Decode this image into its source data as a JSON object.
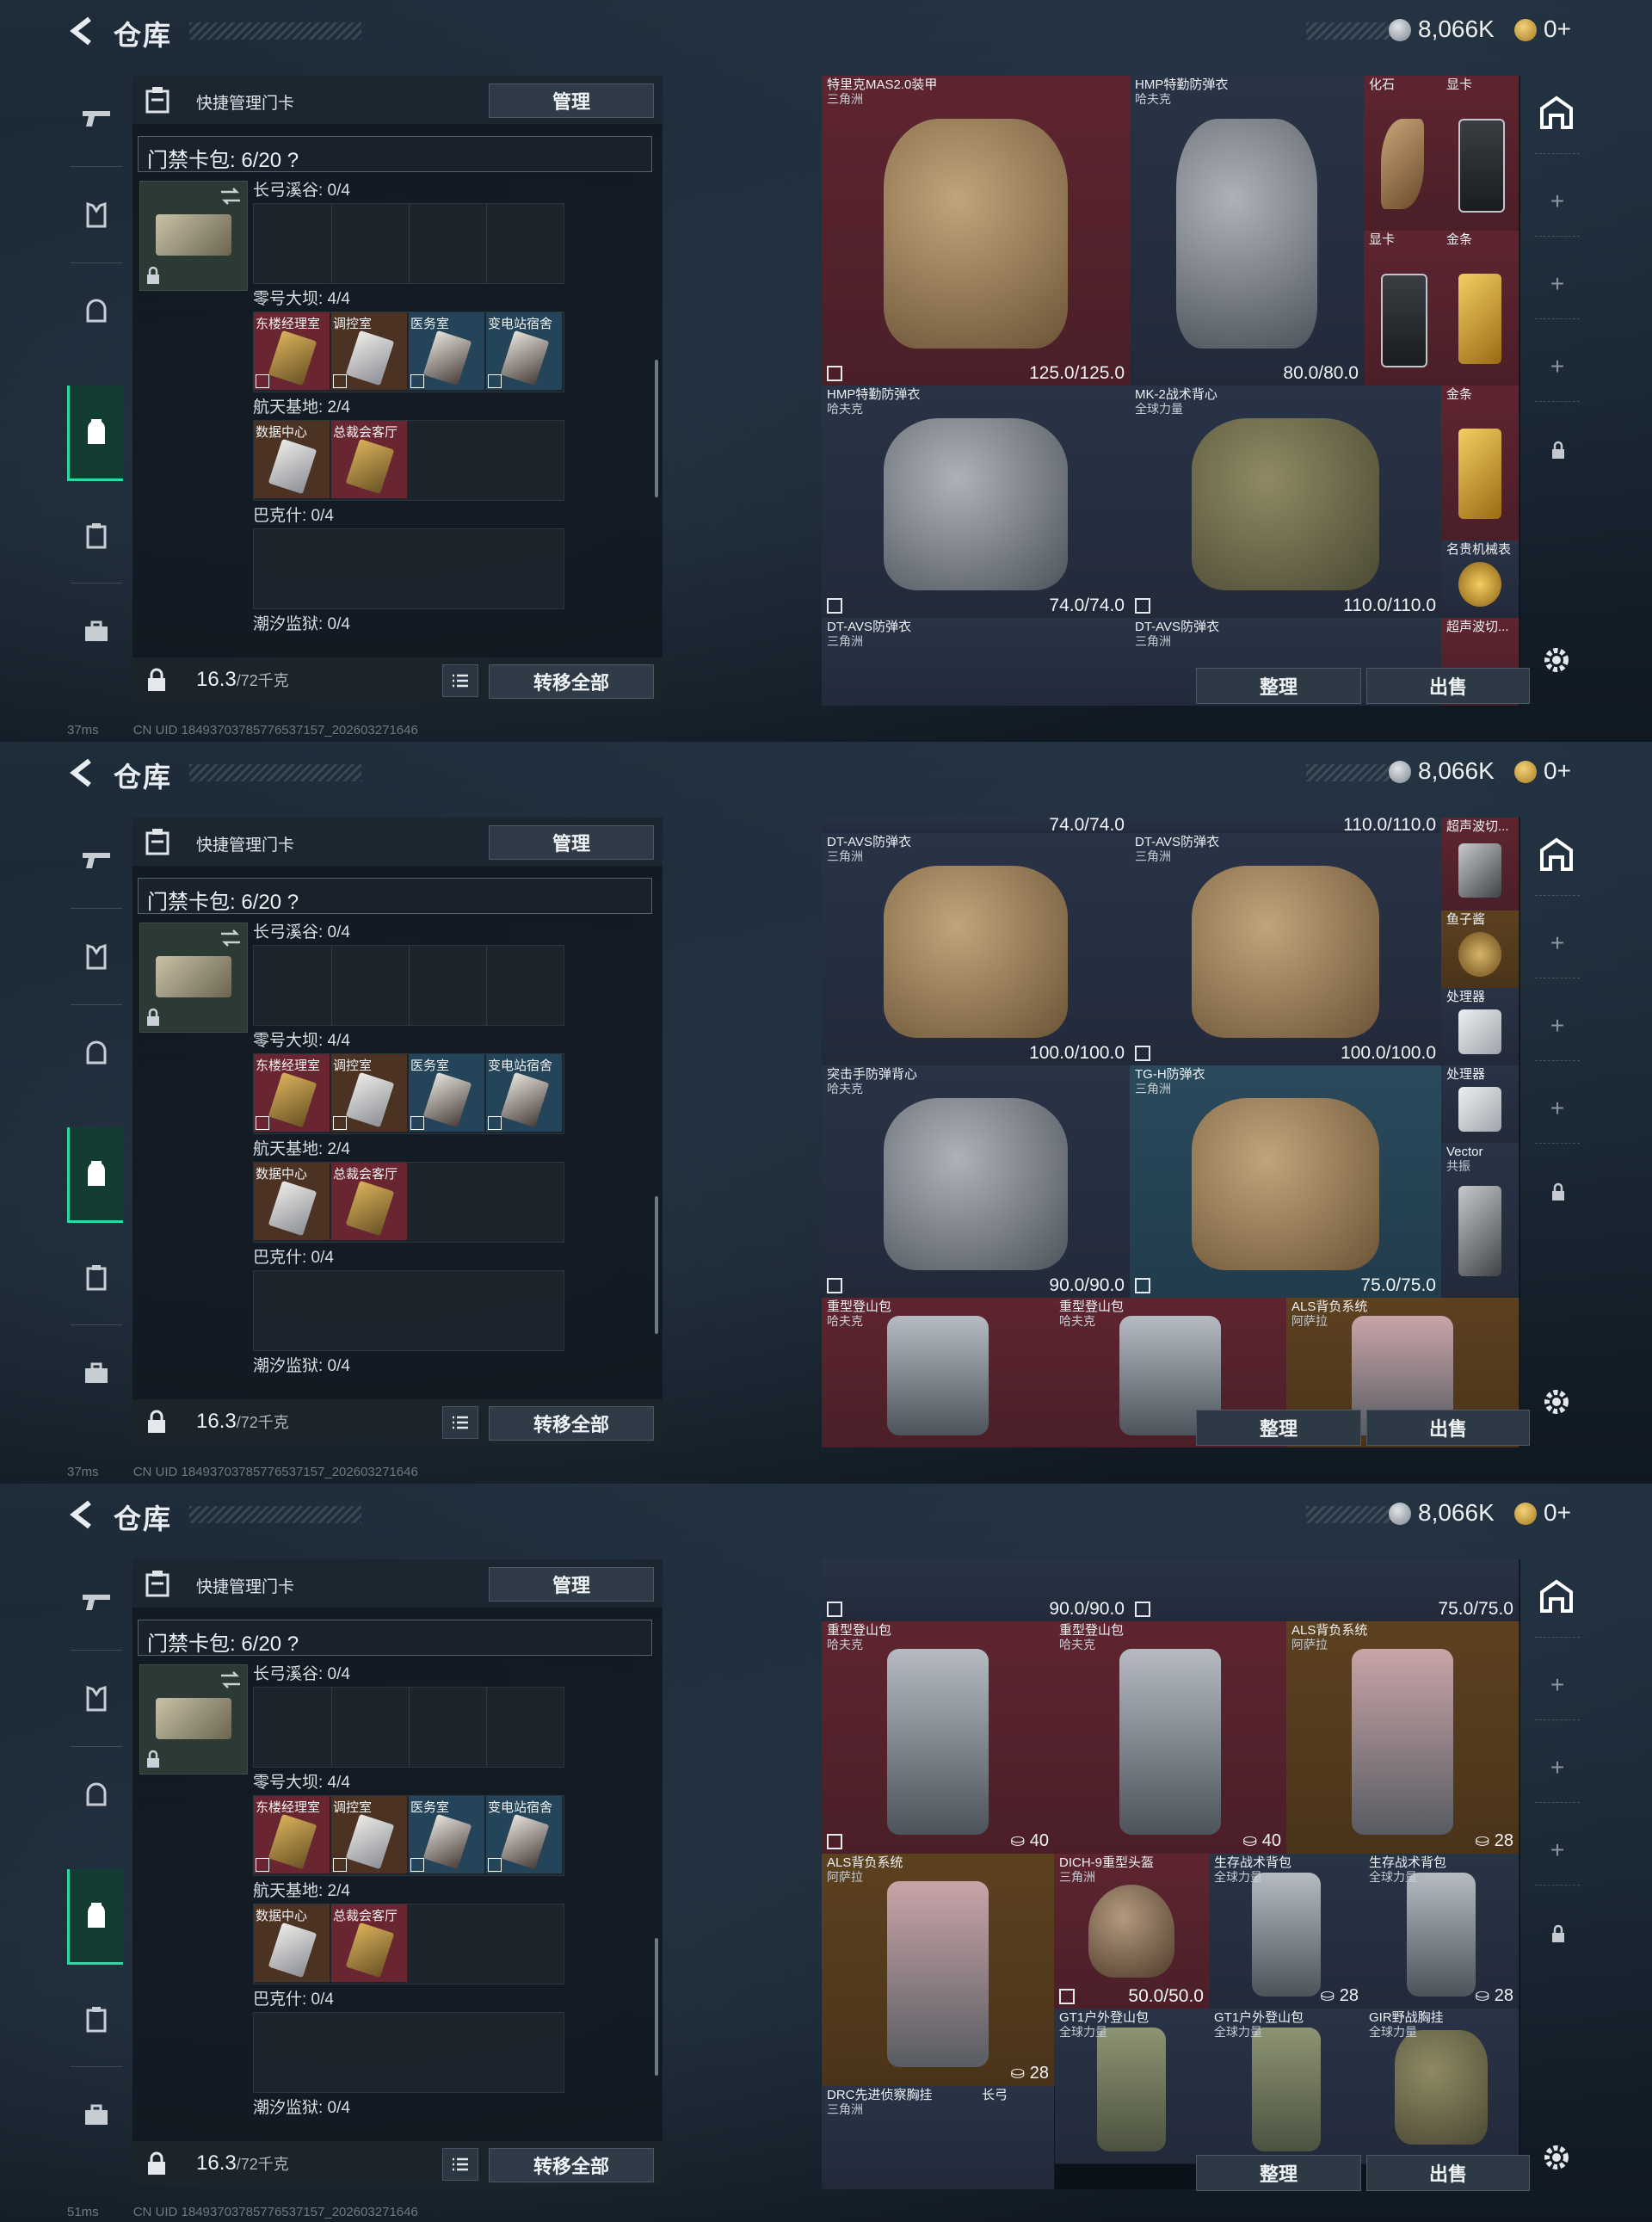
{
  "header": {
    "title": "仓库",
    "currency_silver": "8,066K",
    "currency_gold": "0+"
  },
  "left": {
    "quick_manage_label": "快捷管理门卡",
    "manage_button": "管理",
    "cardpack_label": "门禁卡包: 6/20 ?",
    "regions": [
      {
        "label": "长弓溪谷: 0/4"
      },
      {
        "label": "零号大坝: 4/4"
      },
      {
        "label": "航天基地: 2/4"
      },
      {
        "label": "巴克什: 0/4"
      },
      {
        "label": "潮汐监狱: 0/4"
      }
    ],
    "dam_keys": [
      "东楼经理室",
      "调控室",
      "医务室",
      "变电站宿舍"
    ],
    "space_keys": [
      "数据中心",
      "总裁会客厅"
    ],
    "weight_value": "16.3",
    "weight_unit": "/72千克",
    "transfer_button": "转移全部"
  },
  "status": [
    {
      "ping": "37ms",
      "uid": "CN UID 18493703785776537157_202603271646"
    },
    {
      "ping": "37ms",
      "uid": "CN UID 18493703785776537157_202603271646"
    },
    {
      "ping": "51ms",
      "uid": "CN UID 18493703785776537157_202603271646"
    }
  ],
  "right": {
    "sort_button": "整理",
    "sell_button": "出售"
  },
  "panel1_items": [
    {
      "name": "特里克MAS2.0装甲",
      "sub": "三角洲",
      "dur": "125.0/125.0"
    },
    {
      "name": "HMP特勤防弹衣",
      "sub": "哈夫克",
      "dur": "80.0/80.0"
    },
    {
      "name": "化石",
      "sub": "",
      "dur": ""
    },
    {
      "name": "显卡",
      "sub": "",
      "dur": ""
    },
    {
      "name": "显卡",
      "sub": "",
      "dur": ""
    },
    {
      "name": "金条",
      "sub": "",
      "dur": ""
    },
    {
      "name": "HMP特勤防弹衣",
      "sub": "哈夫克",
      "dur": "74.0/74.0"
    },
    {
      "name": "MK-2战术背心",
      "sub": "全球力量",
      "dur": "110.0/110.0"
    },
    {
      "name": "金条",
      "sub": "",
      "dur": ""
    },
    {
      "name": "名贵机械表",
      "sub": "",
      "dur": ""
    },
    {
      "name": "DT-AVS防弹衣",
      "sub": "三角洲",
      "dur": ""
    },
    {
      "name": "DT-AVS防弹衣",
      "sub": "三角洲",
      "dur": ""
    },
    {
      "name": "超声波切...",
      "sub": "",
      "dur": ""
    }
  ],
  "panel2_items": [
    {
      "name": "",
      "sub": "",
      "dur": "74.0/74.0"
    },
    {
      "name": "",
      "sub": "",
      "dur": "110.0/110.0"
    },
    {
      "name": "DT-AVS防弹衣",
      "sub": "三角洲",
      "dur": "100.0/100.0"
    },
    {
      "name": "DT-AVS防弹衣",
      "sub": "三角洲",
      "dur": "100.0/100.0"
    },
    {
      "name": "超声波切...",
      "sub": "",
      "dur": ""
    },
    {
      "name": "鱼子酱",
      "sub": "",
      "dur": ""
    },
    {
      "name": "处理器",
      "sub": "",
      "dur": ""
    },
    {
      "name": "突击手防弹背心",
      "sub": "哈夫克",
      "dur": "90.0/90.0"
    },
    {
      "name": "TG-H防弹衣",
      "sub": "三角洲",
      "dur": "75.0/75.0"
    },
    {
      "name": "处理器",
      "sub": "",
      "dur": ""
    },
    {
      "name": "Vector",
      "sub": "共振",
      "dur": ""
    },
    {
      "name": "重型登山包",
      "sub": "哈夫克",
      "dur": ""
    },
    {
      "name": "重型登山包",
      "sub": "哈夫克",
      "dur": ""
    },
    {
      "name": "ALS背负系统",
      "sub": "阿萨拉",
      "dur": ""
    }
  ],
  "panel3_items": [
    {
      "name": "",
      "sub": "",
      "dur": "90.0/90.0"
    },
    {
      "name": "",
      "sub": "",
      "dur": "75.0/75.0"
    },
    {
      "name": "重型登山包",
      "sub": "哈夫克",
      "wgt": "40"
    },
    {
      "name": "重型登山包",
      "sub": "哈夫克",
      "wgt": "40"
    },
    {
      "name": "ALS背负系统",
      "sub": "阿萨拉",
      "wgt": "28"
    },
    {
      "name": "ALS背负系统",
      "sub": "阿萨拉",
      "wgt": "28"
    },
    {
      "name": "DICH-9重型头盔",
      "sub": "三角洲",
      "dur": "50.0/50.0"
    },
    {
      "name": "生存战术背包",
      "sub": "全球力量",
      "wgt": "28"
    },
    {
      "name": "生存战术背包",
      "sub": "全球力量",
      "wgt": "28"
    },
    {
      "name": "GT1户外登山包",
      "sub": "全球力量",
      "wgt": ""
    },
    {
      "name": "GT1户外登山包",
      "sub": "全球力量",
      "wgt": ""
    },
    {
      "name": "GIR野战胸挂",
      "sub": "全球力量",
      "wgt": ""
    },
    {
      "name": "DRC先进侦察胸挂",
      "sub": "三角洲",
      "wgt": ""
    },
    {
      "name": "长弓",
      "sub": "",
      "wgt": ""
    }
  ]
}
